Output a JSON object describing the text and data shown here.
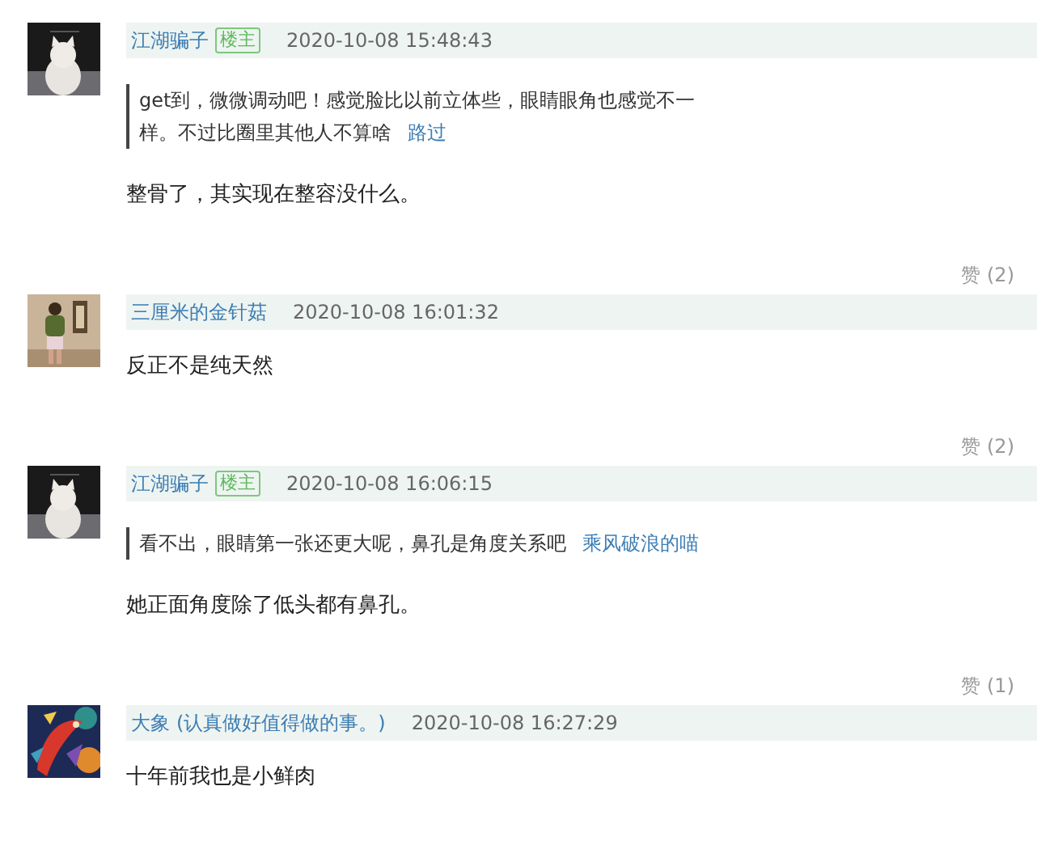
{
  "comments": [
    {
      "author": "江湖骗子",
      "badge": "楼主",
      "time": "2020-10-08 15:48:43",
      "quote": {
        "text": "get到，微微调动吧！感觉脸比以前立体些，眼睛眼角也感觉不一样。不过比圈里其他人不算啥",
        "author": "路过"
      },
      "body": "整骨了，其实现在整容没什么。"
    },
    {
      "likes": "赞 (2)",
      "author": "三厘米的金针菇",
      "time": "2020-10-08 16:01:32",
      "body": "反正不是纯天然"
    },
    {
      "likes": "赞 (2)",
      "author": "江湖骗子",
      "badge": "楼主",
      "time": "2020-10-08 16:06:15",
      "quote": {
        "text": "看不出，眼睛第一张还更大呢，鼻孔是角度关系吧",
        "author": "乘风破浪的喵"
      },
      "body": "她正面角度除了低头都有鼻孔。"
    },
    {
      "likes": "赞 (1)",
      "author": "大象",
      "signature": "(认真做好值得做的事。)",
      "time": "2020-10-08 16:27:29",
      "body": "十年前我也是小鲜肉"
    }
  ]
}
